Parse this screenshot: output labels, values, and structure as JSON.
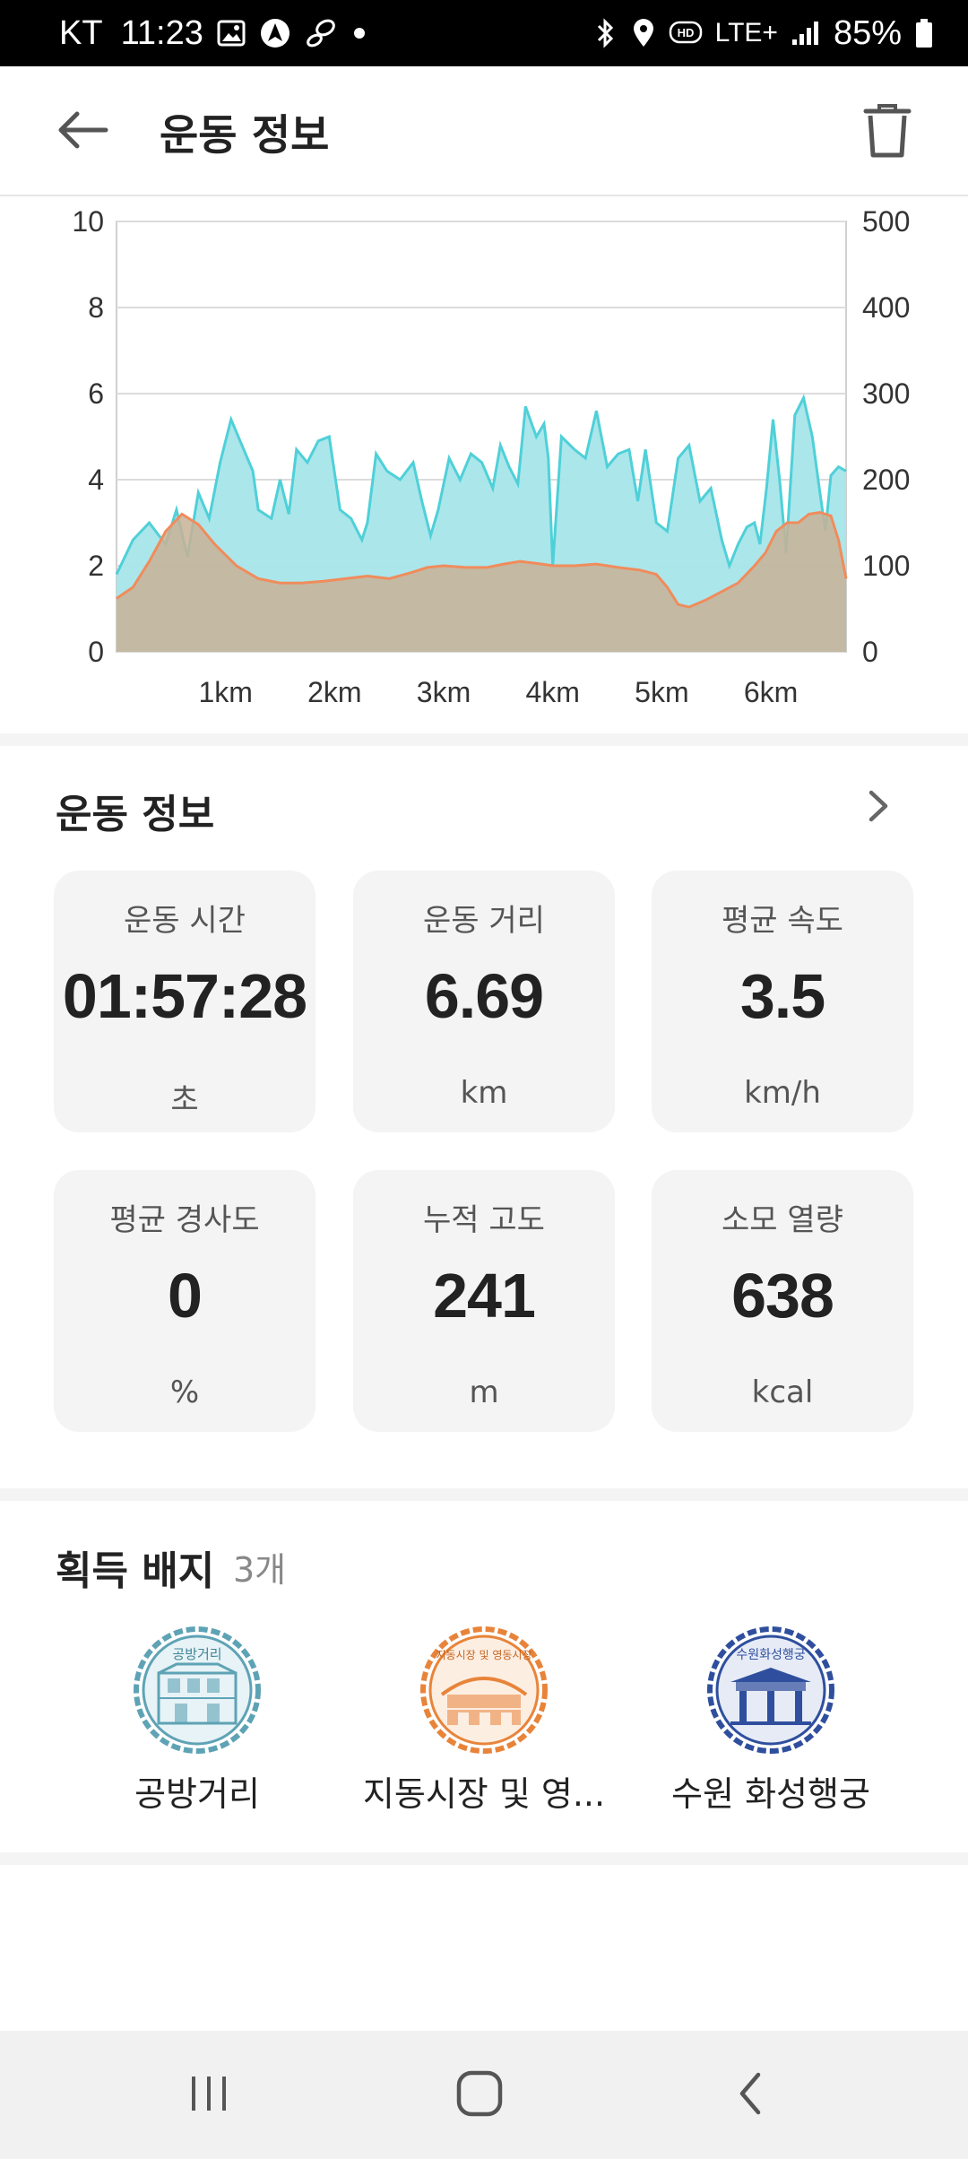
{
  "status_bar": {
    "carrier": "KT",
    "time": "11:23",
    "network": "LTE+",
    "battery": "85%"
  },
  "header": {
    "title": "운동 정보"
  },
  "chart_data": {
    "type": "area",
    "xlabel": "",
    "ylabel": "",
    "x_ticks": [
      "1km",
      "2km",
      "3km",
      "4km",
      "5km",
      "6km"
    ],
    "y_left_ticks": [
      "0",
      "2",
      "4",
      "6",
      "8",
      "10"
    ],
    "y_right_ticks": [
      "0",
      "100",
      "200",
      "300",
      "400",
      "500"
    ],
    "ylim_left": [
      0,
      10
    ],
    "ylim_right": [
      0,
      500
    ],
    "xlim": [
      0,
      6.69
    ],
    "grid": true,
    "series": [
      {
        "axis": "left",
        "color": "#4fd0d8",
        "fill": "#a6e5ea",
        "points": [
          [
            0,
            1.8
          ],
          [
            0.15,
            2.6
          ],
          [
            0.3,
            3.0
          ],
          [
            0.45,
            2.5
          ],
          [
            0.55,
            3.3
          ],
          [
            0.65,
            2.2
          ],
          [
            0.75,
            3.7
          ],
          [
            0.85,
            3.1
          ],
          [
            0.95,
            4.4
          ],
          [
            1.05,
            5.4
          ],
          [
            1.15,
            4.8
          ],
          [
            1.25,
            4.2
          ],
          [
            1.3,
            3.3
          ],
          [
            1.42,
            3.1
          ],
          [
            1.5,
            4.0
          ],
          [
            1.58,
            3.2
          ],
          [
            1.65,
            4.7
          ],
          [
            1.75,
            4.4
          ],
          [
            1.85,
            4.9
          ],
          [
            1.95,
            5.0
          ],
          [
            2.05,
            3.3
          ],
          [
            2.15,
            3.1
          ],
          [
            2.25,
            2.6
          ],
          [
            2.3,
            3.0
          ],
          [
            2.38,
            4.6
          ],
          [
            2.48,
            4.2
          ],
          [
            2.6,
            4.0
          ],
          [
            2.72,
            4.4
          ],
          [
            2.8,
            3.5
          ],
          [
            2.88,
            2.7
          ],
          [
            2.95,
            3.3
          ],
          [
            3.05,
            4.5
          ],
          [
            3.15,
            4.0
          ],
          [
            3.25,
            4.6
          ],
          [
            3.35,
            4.4
          ],
          [
            3.45,
            3.8
          ],
          [
            3.52,
            4.8
          ],
          [
            3.6,
            4.3
          ],
          [
            3.68,
            3.9
          ],
          [
            3.75,
            5.7
          ],
          [
            3.85,
            5.0
          ],
          [
            3.92,
            5.3
          ],
          [
            3.96,
            4.5
          ],
          [
            4.0,
            2.0
          ],
          [
            4.08,
            5.0
          ],
          [
            4.2,
            4.7
          ],
          [
            4.3,
            4.5
          ],
          [
            4.4,
            5.6
          ],
          [
            4.5,
            4.3
          ],
          [
            4.6,
            4.6
          ],
          [
            4.7,
            4.7
          ],
          [
            4.78,
            3.5
          ],
          [
            4.85,
            4.7
          ],
          [
            4.95,
            3.0
          ],
          [
            5.05,
            2.8
          ],
          [
            5.15,
            4.5
          ],
          [
            5.25,
            4.8
          ],
          [
            5.35,
            3.5
          ],
          [
            5.45,
            3.8
          ],
          [
            5.55,
            2.6
          ],
          [
            5.62,
            2.0
          ],
          [
            5.7,
            2.5
          ],
          [
            5.78,
            2.9
          ],
          [
            5.85,
            3.0
          ],
          [
            5.9,
            2.5
          ],
          [
            5.96,
            3.8
          ],
          [
            6.02,
            5.4
          ],
          [
            6.08,
            4.0
          ],
          [
            6.14,
            2.3
          ],
          [
            6.22,
            5.5
          ],
          [
            6.3,
            5.9
          ],
          [
            6.38,
            5.0
          ],
          [
            6.45,
            3.7
          ],
          [
            6.5,
            2.8
          ],
          [
            6.55,
            4.1
          ],
          [
            6.62,
            4.3
          ],
          [
            6.69,
            4.2
          ]
        ]
      },
      {
        "axis": "right",
        "color": "#f08c5c",
        "fill": "#c8b296",
        "points": [
          [
            0,
            62
          ],
          [
            0.15,
            75
          ],
          [
            0.3,
            105
          ],
          [
            0.45,
            140
          ],
          [
            0.6,
            160
          ],
          [
            0.75,
            148
          ],
          [
            0.9,
            125
          ],
          [
            1.1,
            100
          ],
          [
            1.3,
            85
          ],
          [
            1.5,
            80
          ],
          [
            1.7,
            80
          ],
          [
            1.9,
            82
          ],
          [
            2.1,
            85
          ],
          [
            2.3,
            88
          ],
          [
            2.5,
            85
          ],
          [
            2.7,
            92
          ],
          [
            2.85,
            98
          ],
          [
            3.0,
            100
          ],
          [
            3.2,
            98
          ],
          [
            3.4,
            98
          ],
          [
            3.55,
            102
          ],
          [
            3.7,
            105
          ],
          [
            3.9,
            102
          ],
          [
            4.0,
            100
          ],
          [
            4.2,
            100
          ],
          [
            4.4,
            102
          ],
          [
            4.6,
            98
          ],
          [
            4.8,
            95
          ],
          [
            4.95,
            90
          ],
          [
            5.05,
            75
          ],
          [
            5.15,
            55
          ],
          [
            5.25,
            52
          ],
          [
            5.4,
            60
          ],
          [
            5.55,
            70
          ],
          [
            5.7,
            80
          ],
          [
            5.85,
            100
          ],
          [
            5.95,
            115
          ],
          [
            6.05,
            140
          ],
          [
            6.15,
            150
          ],
          [
            6.25,
            150
          ],
          [
            6.35,
            160
          ],
          [
            6.45,
            162
          ],
          [
            6.55,
            158
          ],
          [
            6.62,
            130
          ],
          [
            6.69,
            85
          ]
        ]
      }
    ]
  },
  "exercise_section": {
    "title": "운동 정보"
  },
  "stats": [
    {
      "label": "운동 시간",
      "value": "01:57:28",
      "unit": "초"
    },
    {
      "label": "운동 거리",
      "value": "6.69",
      "unit": "km"
    },
    {
      "label": "평균 속도",
      "value": "3.5",
      "unit": "km/h"
    },
    {
      "label": "평균 경사도",
      "value": "0",
      "unit": "%"
    },
    {
      "label": "누적 고도",
      "value": "241",
      "unit": "m"
    },
    {
      "label": "소모 열량",
      "value": "638",
      "unit": "kcal"
    }
  ],
  "badges_section": {
    "title": "획득 배지",
    "count": "3개",
    "items": [
      {
        "name": "공방거리",
        "stamp_text": "공방거리",
        "color": "#5ea3b5"
      },
      {
        "name": "지동시장 및 영...",
        "stamp_text": "지동시장 및 영동시장",
        "color": "#e8843a"
      },
      {
        "name": "수원 화성행궁",
        "stamp_text": "수원화성행궁",
        "color": "#2f4f9e"
      }
    ]
  }
}
